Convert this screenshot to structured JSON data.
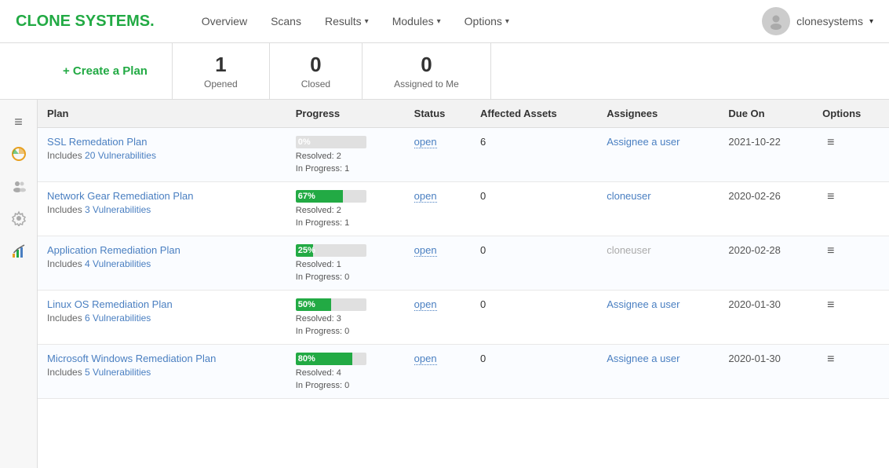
{
  "header": {
    "logo_text": "CLONE SYSTEMS.",
    "logo_highlight": "CLONE",
    "nav": [
      {
        "label": "Overview",
        "has_dropdown": false
      },
      {
        "label": "Scans",
        "has_dropdown": false
      },
      {
        "label": "Results",
        "has_dropdown": true
      },
      {
        "label": "Modules",
        "has_dropdown": true
      },
      {
        "label": "Options",
        "has_dropdown": true
      }
    ],
    "user": "clonesystems"
  },
  "stats": {
    "create_label": "+ Create a Plan",
    "items": [
      {
        "number": "1",
        "label": "Opened"
      },
      {
        "number": "0",
        "label": "Closed"
      },
      {
        "number": "0",
        "label": "Assigned to Me"
      }
    ]
  },
  "sidebar": {
    "icons": [
      {
        "name": "menu-icon",
        "glyph": "≡"
      },
      {
        "name": "chart-icon",
        "glyph": "📊"
      },
      {
        "name": "users-icon",
        "glyph": "👥"
      },
      {
        "name": "settings-icon",
        "glyph": "⚙"
      },
      {
        "name": "report-icon",
        "glyph": "📈"
      }
    ]
  },
  "table": {
    "columns": [
      "Plan",
      "Progress",
      "Status",
      "Affected Assets",
      "Assignees",
      "Due On",
      "Options"
    ],
    "rows": [
      {
        "plan_name": "SSL Remedation Plan",
        "plan_includes": "Includes 20 Vulnerabilities",
        "vuln_count": "20",
        "progress_pct": 0,
        "progress_label": "0%",
        "resolved": "Resolved: 2",
        "in_progress": "In Progress: 1",
        "status": "open",
        "affected_assets": "6",
        "assignee": "Assignee a user",
        "assignee_type": "link",
        "due_on": "2021-10-22"
      },
      {
        "plan_name": "Network Gear Remediation Plan",
        "plan_includes": "Includes 3 Vulnerabilities",
        "vuln_count": "3",
        "progress_pct": 67,
        "progress_label": "67%",
        "resolved": "Resolved: 2",
        "in_progress": "In Progress: 1",
        "status": "open",
        "affected_assets": "0",
        "assignee": "cloneuser",
        "assignee_type": "link",
        "due_on": "2020-02-26"
      },
      {
        "plan_name": "Application Remediation Plan",
        "plan_includes": "Includes 4 Vulnerabilities",
        "vuln_count": "4",
        "progress_pct": 25,
        "progress_label": "25%",
        "resolved": "Resolved: 1",
        "in_progress": "In Progress: 0",
        "status": "open",
        "affected_assets": "0",
        "assignee": "cloneuser",
        "assignee_type": "muted",
        "due_on": "2020-02-28"
      },
      {
        "plan_name": "Linux OS Remediation Plan",
        "plan_includes": "Includes 6 Vulnerabilities",
        "vuln_count": "6",
        "progress_pct": 50,
        "progress_label": "50%",
        "resolved": "Resolved: 3",
        "in_progress": "In Progress: 0",
        "status": "open",
        "affected_assets": "0",
        "assignee": "Assignee a user",
        "assignee_type": "link",
        "due_on": "2020-01-30"
      },
      {
        "plan_name": "Microsoft Windows Remediation Plan",
        "plan_includes": "Includes 5 Vulnerabilities",
        "vuln_count": "5",
        "progress_pct": 80,
        "progress_label": "80%",
        "resolved": "Resolved: 4",
        "in_progress": "In Progress: 0",
        "status": "open",
        "affected_assets": "0",
        "assignee": "Assignee a user",
        "assignee_type": "link",
        "due_on": "2020-01-30"
      }
    ]
  }
}
